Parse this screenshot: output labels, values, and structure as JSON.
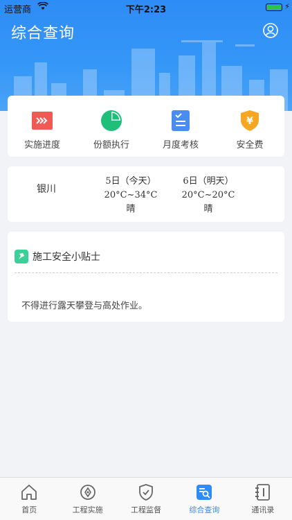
{
  "status_bar": {
    "carrier": "运营商",
    "time": "下午2:23"
  },
  "header": {
    "title": "综合查询"
  },
  "menu": [
    {
      "label": "实施进度",
      "icon": "progress-icon",
      "color": "#f05a54"
    },
    {
      "label": "份额执行",
      "icon": "pie-chart-icon",
      "color": "#1fbf7a"
    },
    {
      "label": "月度考核",
      "icon": "checklist-icon",
      "color": "#4a8cf0"
    },
    {
      "label": "安全费",
      "icon": "yuan-shield-icon",
      "color": "#f5a623"
    }
  ],
  "weather": {
    "city": "银川",
    "days": [
      {
        "date": "5日（今天）",
        "temp": "20°C~34°C",
        "condition": "晴"
      },
      {
        "date": "6日（明天）",
        "temp": "20°C~20°C",
        "condition": "晴"
      }
    ]
  },
  "tips": {
    "title": "施工安全小贴士",
    "content": "不得进行露天攀登与高处作业。"
  },
  "tabbar": {
    "active_color": "#2e8cf6",
    "items": [
      {
        "label": "首页",
        "icon": "home-icon"
      },
      {
        "label": "工程实施",
        "icon": "compass-icon"
      },
      {
        "label": "工程监督",
        "icon": "shield-check-icon"
      },
      {
        "label": "综合查询",
        "icon": "search-doc-icon"
      },
      {
        "label": "通讯录",
        "icon": "contacts-icon"
      }
    ]
  }
}
